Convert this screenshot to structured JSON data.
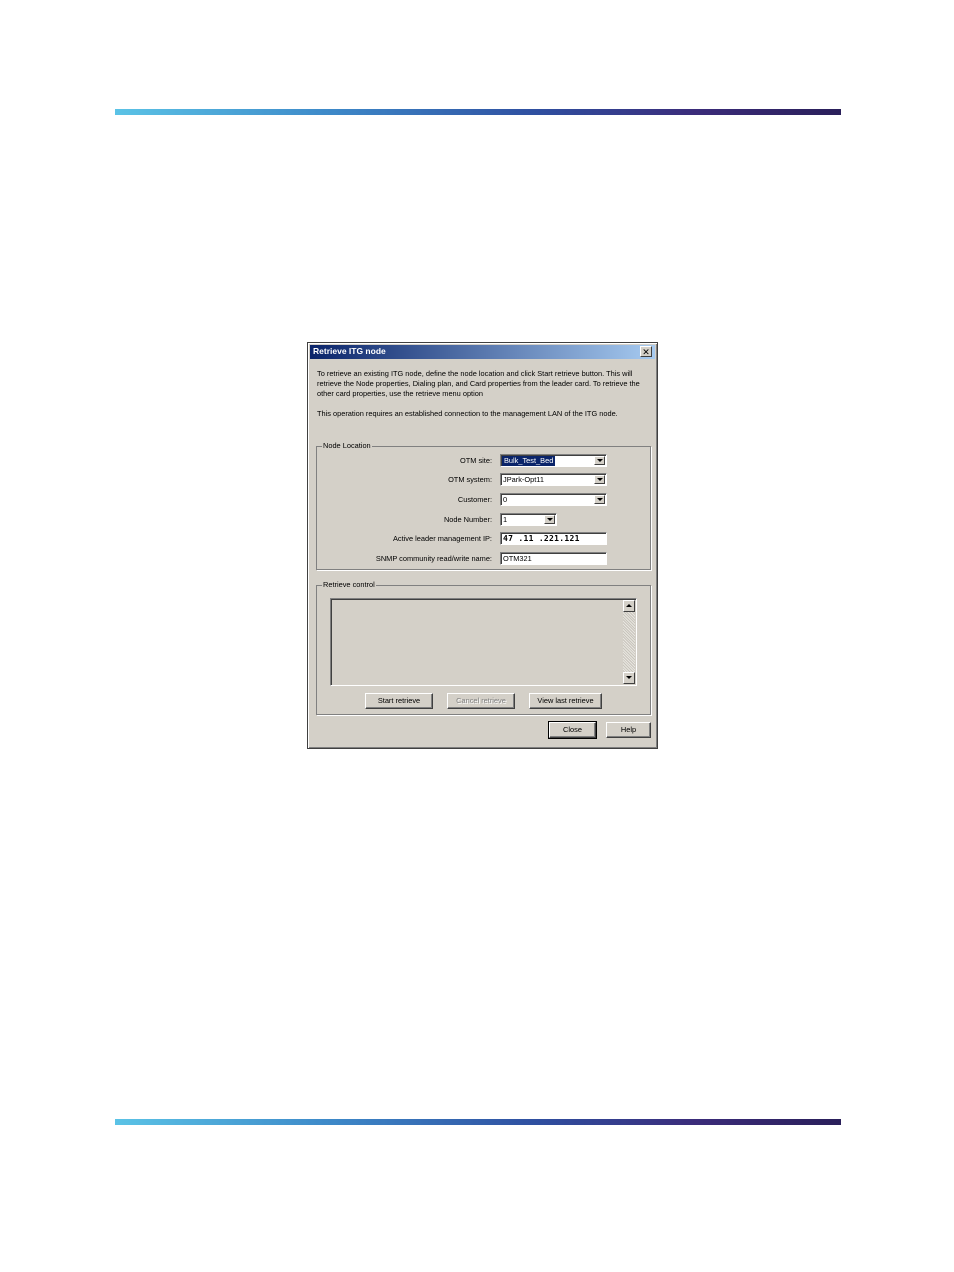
{
  "dialog": {
    "title": "Retrieve ITG node",
    "close_glyph": "✕",
    "intro_paragraph_1": "To retrieve an existing ITG node, define the node location and click Start retrieve button. This will retrieve the Node properties, Dialing plan, and Card properties from the leader card. To retrieve the other card properties, use the retrieve menu option",
    "intro_paragraph_2": "This operation requires an established connection to the management LAN of the ITG node."
  },
  "node_location": {
    "group_label": "Node Location",
    "fields": {
      "otm_site": {
        "label": "OTM site:",
        "value": "Bulk_Test_Bed"
      },
      "otm_system": {
        "label": "OTM system:",
        "value": "JPark-Opt11"
      },
      "customer": {
        "label": "Customer:",
        "value": "0"
      },
      "node_number": {
        "label": "Node Number:",
        "value": "1"
      },
      "leader_ip": {
        "label": "Active leader management IP:",
        "value": "47 .11 .221.121"
      },
      "snmp": {
        "label": "SNMP community read/write name:",
        "value": "OTM321"
      }
    }
  },
  "retrieve_control": {
    "group_label": "Retrieve control",
    "log_text": "",
    "buttons": {
      "start": "Start retrieve",
      "cancel": "Cancel retrieve",
      "view_last": "View last retrieve"
    }
  },
  "footer": {
    "close": "Close",
    "help": "Help"
  }
}
